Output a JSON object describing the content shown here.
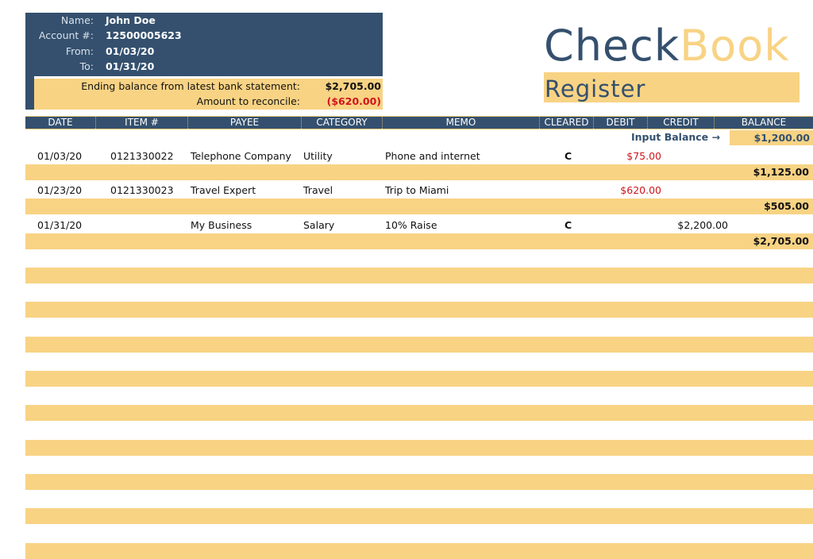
{
  "account": {
    "name_label": "Name:",
    "name": "John Doe",
    "account_label": "Account #:",
    "account_number": "12500005623",
    "from_label": "From:",
    "from_date": "01/03/20",
    "to_label": "To:",
    "to_date": "01/31/20"
  },
  "reconcile": {
    "ending_balance_label": "Ending balance from latest bank statement:",
    "ending_balance": "$2,705.00",
    "amount_label": "Amount to reconcile:",
    "amount": "($620.00)"
  },
  "logo": {
    "part1": "Check",
    "part2": "Book",
    "subtitle": "Register"
  },
  "colors": {
    "navy": "#34506e",
    "gold": "#f8d384",
    "red": "#d0141b"
  },
  "table": {
    "columns": [
      "DATE",
      "ITEM #",
      "PAYEE",
      "CATEGORY",
      "MEMO",
      "CLEARED",
      "DEBIT",
      "CREDIT",
      "BALANCE"
    ],
    "input_balance_label": "Input Balance →",
    "input_balance": "$1,200.00",
    "rows": [
      {
        "date": "01/03/20",
        "item": "0121330022",
        "payee": "Telephone Company",
        "category": "Utility",
        "memo": "Phone and internet",
        "cleared": "C",
        "debit": "$75.00",
        "credit": "",
        "balance": "$1,125.00"
      },
      {
        "date": "01/23/20",
        "item": "0121330023",
        "payee": "Travel Expert",
        "category": "Travel",
        "memo": "Trip to Miami",
        "cleared": "",
        "debit": "$620.00",
        "credit": "",
        "balance": "$505.00"
      },
      {
        "date": "01/31/20",
        "item": "",
        "payee": "My Business",
        "category": "Salary",
        "memo": "10% Raise",
        "cleared": "C",
        "debit": "",
        "credit": "$2,200.00",
        "balance": "$2,705.00"
      }
    ]
  }
}
